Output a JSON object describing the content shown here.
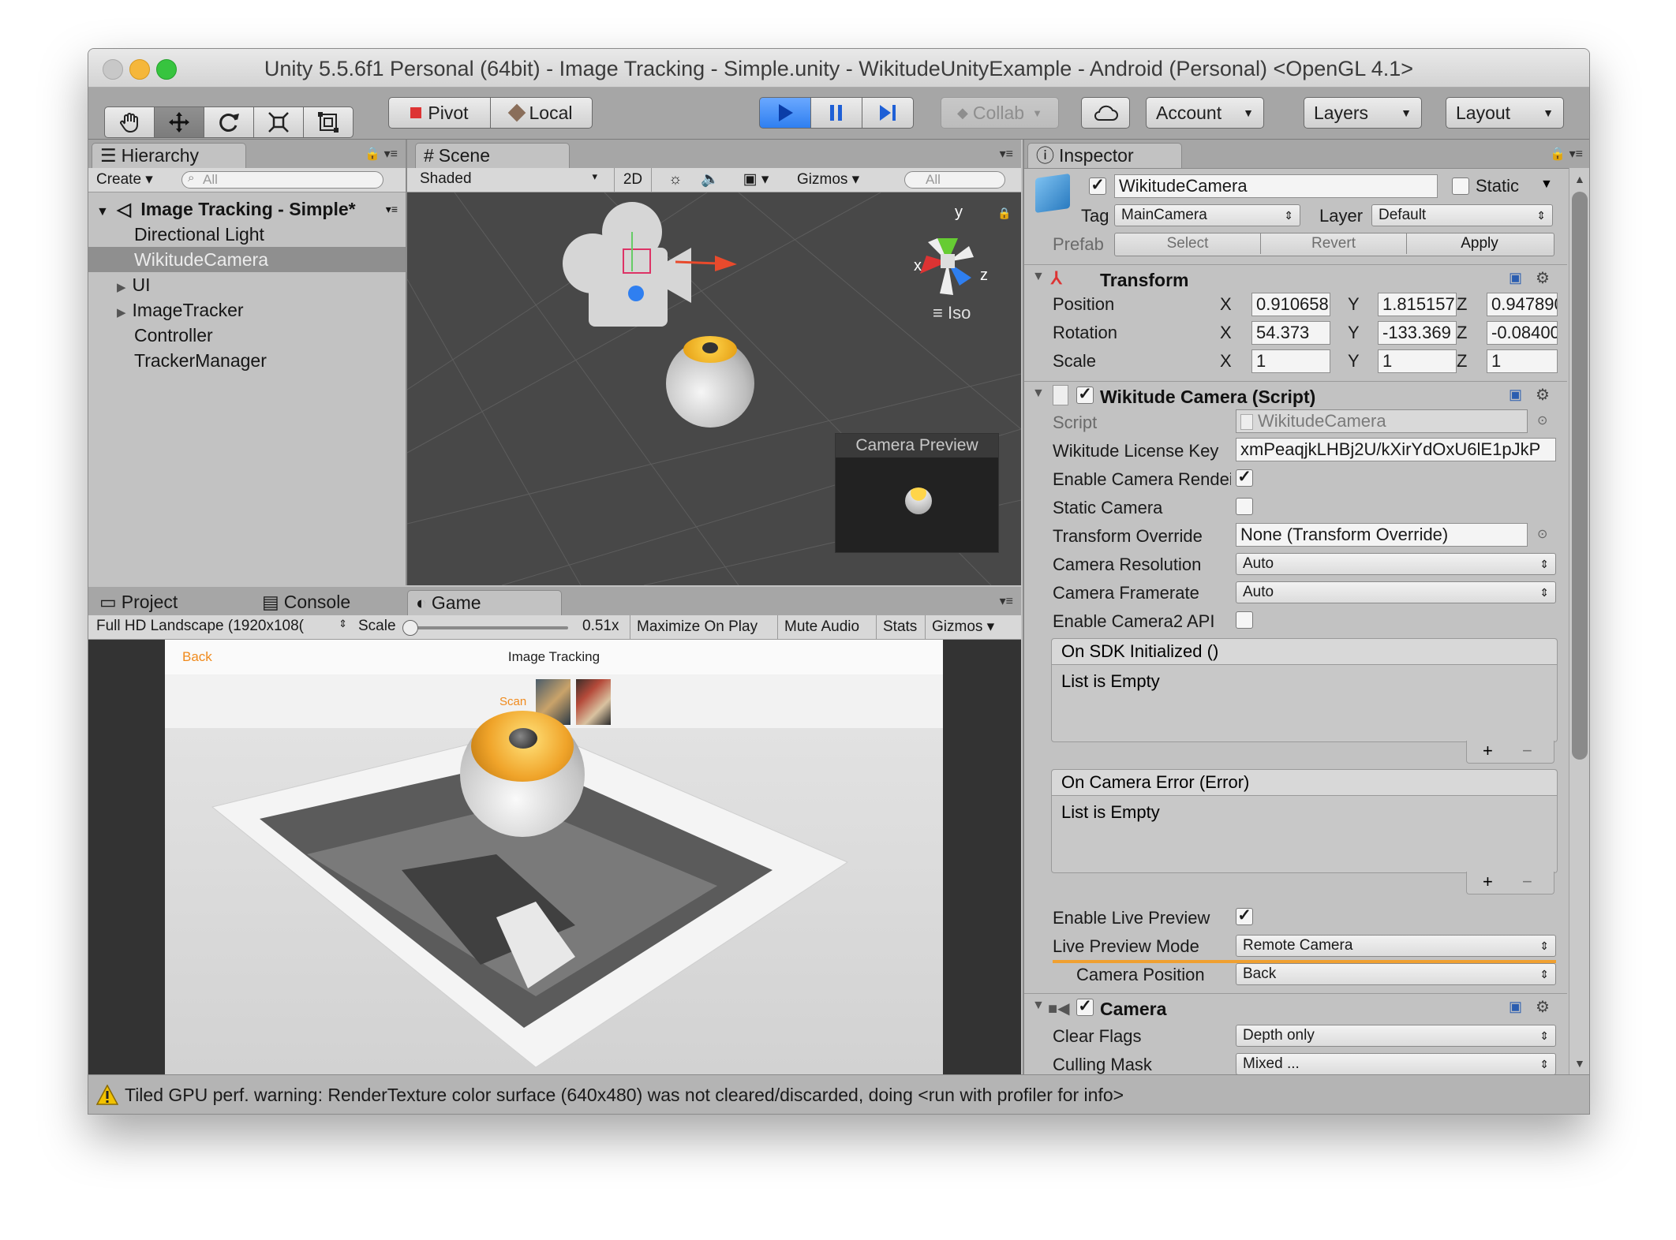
{
  "window": {
    "title": "Unity 5.5.6f1 Personal (64bit) - Image Tracking - Simple.unity - WikitudeUnityExample - Android (Personal) <OpenGL 4.1>"
  },
  "toolbar": {
    "tool_icons": [
      "hand-icon",
      "move-icon",
      "rotate-icon",
      "scale-icon",
      "rect-icon"
    ],
    "pivot": "Pivot",
    "local": "Local",
    "collab": "Collab",
    "account": "Account",
    "layers": "Layers",
    "layout": "Layout"
  },
  "hierarchy": {
    "tab": "Hierarchy",
    "create": "Create",
    "search_placeholder": "All",
    "scene": "Image Tracking - Simple*",
    "items": [
      "Directional Light",
      "WikitudeCamera",
      "UI",
      "ImageTracker",
      "Controller",
      "TrackerManager"
    ]
  },
  "scene": {
    "tab": "Scene",
    "shading": "Shaded",
    "mode_2d": "2D",
    "gizmos": "Gizmos",
    "search_placeholder": "All",
    "iso": "Iso",
    "axis_x": "x",
    "axis_y": "y",
    "axis_z": "z",
    "camera_preview": "Camera Preview"
  },
  "bottom_tabs": {
    "project": "Project",
    "console": "Console",
    "game": "Game"
  },
  "game": {
    "resolution": "Full HD Landscape (1920x108(",
    "scale_label": "Scale",
    "scale_value": "0.51x",
    "scale_fraction": 0.0,
    "maximize": "Maximize On Play",
    "mute": "Mute Audio",
    "stats": "Stats",
    "gizmos": "Gizmos",
    "app_back": "Back",
    "app_title": "Image Tracking",
    "app_scan": "Scan"
  },
  "inspector": {
    "tab": "Inspector",
    "object_name": "WikitudeCamera",
    "static_label": "Static",
    "tag_label": "Tag",
    "tag_value": "MainCamera",
    "layer_label": "Layer",
    "layer_value": "Default",
    "prefab_label": "Prefab",
    "prefab_select": "Select",
    "prefab_revert": "Revert",
    "prefab_apply": "Apply",
    "transform": {
      "title": "Transform",
      "rows": [
        {
          "label": "Position",
          "x": "0.910658",
          "y": "1.815157",
          "z": "0.947890"
        },
        {
          "label": "Rotation",
          "x": "54.373",
          "y": "-133.369",
          "z": "-0.084000"
        },
        {
          "label": "Scale",
          "x": "1",
          "y": "1",
          "z": "1"
        }
      ]
    },
    "wikitude": {
      "title": "Wikitude Camera (Script)",
      "script_label": "Script",
      "script_value": "WikitudeCamera",
      "license_label": "Wikitude License Key",
      "license_value": "xmPeaqjkLHBj2U/kXirYdOxU6lE1pJkP",
      "enable_render_label": "Enable Camera Rendei",
      "static_camera_label": "Static Camera",
      "transform_override_label": "Transform Override",
      "transform_override_value": "None (Transform Override)",
      "resolution_label": "Camera Resolution",
      "resolution_value": "Auto",
      "framerate_label": "Camera Framerate",
      "framerate_value": "Auto",
      "camera2_label": "Enable Camera2 API",
      "sdk_event": "On SDK Initialized ()",
      "error_event": "On Camera Error (Error)",
      "list_empty": "List is Empty",
      "live_preview_label": "Enable Live Preview",
      "live_mode_label": "Live Preview Mode",
      "live_mode_value": "Remote Camera",
      "cam_pos_label": "Camera Position",
      "cam_pos_value": "Back"
    },
    "camera": {
      "title": "Camera",
      "clear_label": "Clear Flags",
      "clear_value": "Depth only",
      "mask_label": "Culling Mask",
      "mask_value": "Mixed ..."
    }
  },
  "status": {
    "warning": "Tiled GPU perf. warning: RenderTexture color surface  (640x480) was not cleared/discarded, doing <run with profiler for info>"
  },
  "colors": {
    "play_blue": "#2f7ff0",
    "accent_orange": "#f0a030",
    "scene_bg": "#4a4a4a"
  }
}
